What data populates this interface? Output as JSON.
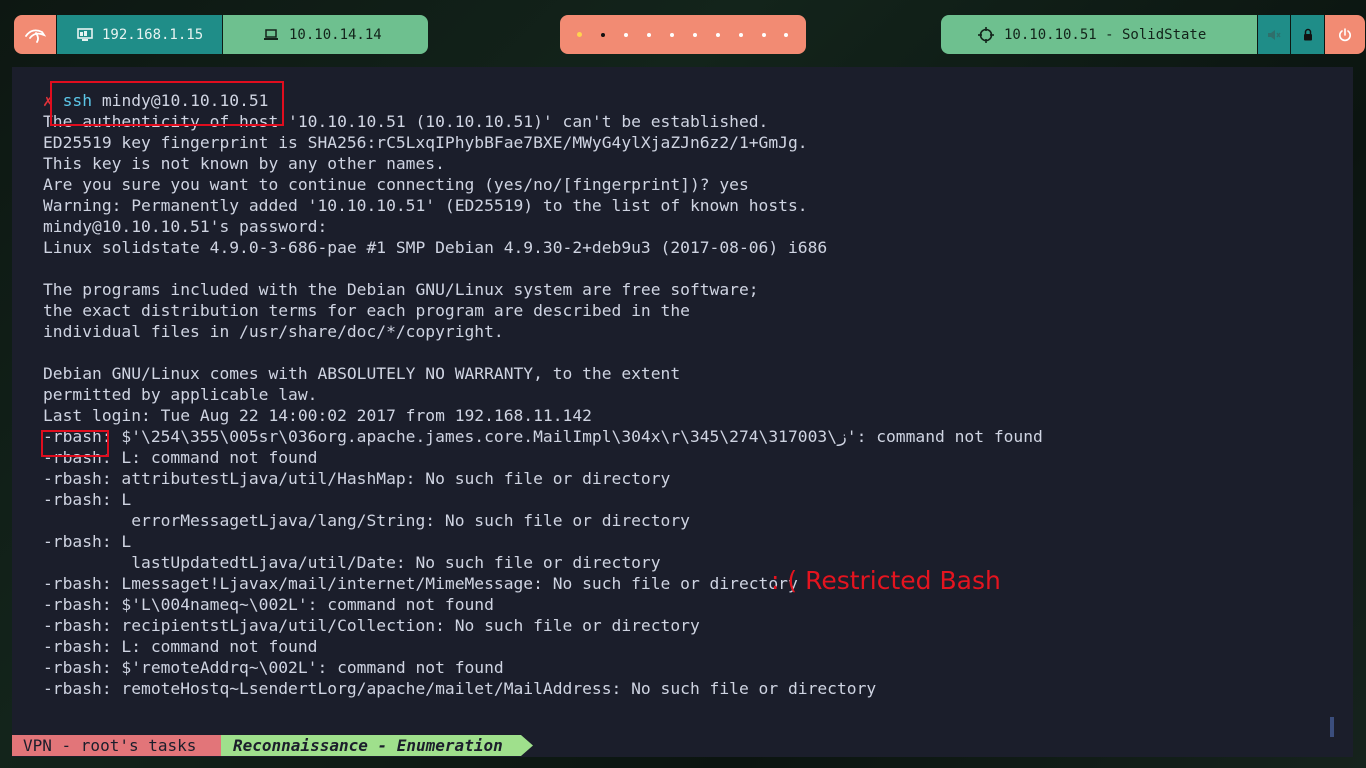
{
  "topbar": {
    "local_ip": "192.168.1.15",
    "vpn_ip": "10.10.14.14",
    "target": "10.10.10.51 - SolidState",
    "workspaces": [
      1,
      2,
      3,
      4,
      5,
      6,
      7,
      8,
      9,
      10
    ],
    "active_workspace": 2,
    "icons": [
      "kali-dragon-icon",
      "monitor-icon",
      "laptop-icon",
      "crosshair-icon",
      "volume-muted-icon",
      "lock-icon",
      "power-icon"
    ]
  },
  "terminal": {
    "prompt_symbol": "✗",
    "command_keyword": "ssh",
    "command_args": " mindy@10.10.10.51",
    "lines": [
      "The authenticity of host '10.10.10.51 (10.10.10.51)' can't be established.",
      "ED25519 key fingerprint is SHA256:rC5LxqIPhybBFae7BXE/MWyG4ylXjaZJn6z2/1+GmJg.",
      "This key is not known by any other names.",
      "Are you sure you want to continue connecting (yes/no/[fingerprint])? yes",
      "Warning: Permanently added '10.10.10.51' (ED25519) to the list of known hosts.",
      "mindy@10.10.10.51's password:",
      "Linux solidstate 4.9.0-3-686-pae #1 SMP Debian 4.9.30-2+deb9u3 (2017-08-06) i686",
      "",
      "The programs included with the Debian GNU/Linux system are free software;",
      "the exact distribution terms for each program are described in the",
      "individual files in /usr/share/doc/*/copyright.",
      "",
      "Debian GNU/Linux comes with ABSOLUTELY NO WARRANTY, to the extent",
      "permitted by applicable law.",
      "Last login: Tue Aug 22 14:00:02 2017 from 192.168.11.142",
      "-rbash: $'\\254\\355\\005sr\\036org.apache.james.core.MailImpl\\304x\\r\\345\\274\\317ز\\003': command not found",
      "-rbash: L: command not found",
      "-rbash: attributestLjava/util/HashMap: No such file or directory",
      "-rbash: L",
      "         errorMessagetLjava/lang/String: No such file or directory",
      "-rbash: L",
      "         lastUpdatedtLjava/util/Date: No such file or directory",
      "-rbash: Lmessaget!Ljavax/mail/internet/MimeMessage: No such file or directory",
      "-rbash: $'L\\004nameq~\\002L': command not found",
      "-rbash: recipientstLjava/util/Collection: No such file or directory",
      "-rbash: L: command not found",
      "-rbash: $'remoteAddrq~\\002L': command not found",
      "-rbash: remoteHostq~LsendertLorg/apache/mailet/MailAddress: No such file or directory"
    ],
    "annotation": ": ( Restricted Bash",
    "highlight_color": "#e00d1e"
  },
  "statusbar": {
    "left": "VPN - root's tasks",
    "right": "Reconnaissance - Enumeration"
  },
  "colors": {
    "accent_salmon": "#f28b73",
    "accent_teal": "#1f8d88",
    "accent_green": "#6ec08f",
    "terminal_bg": "#1b1e2b",
    "status_left": "#e27579",
    "status_right": "#9fe08c"
  }
}
